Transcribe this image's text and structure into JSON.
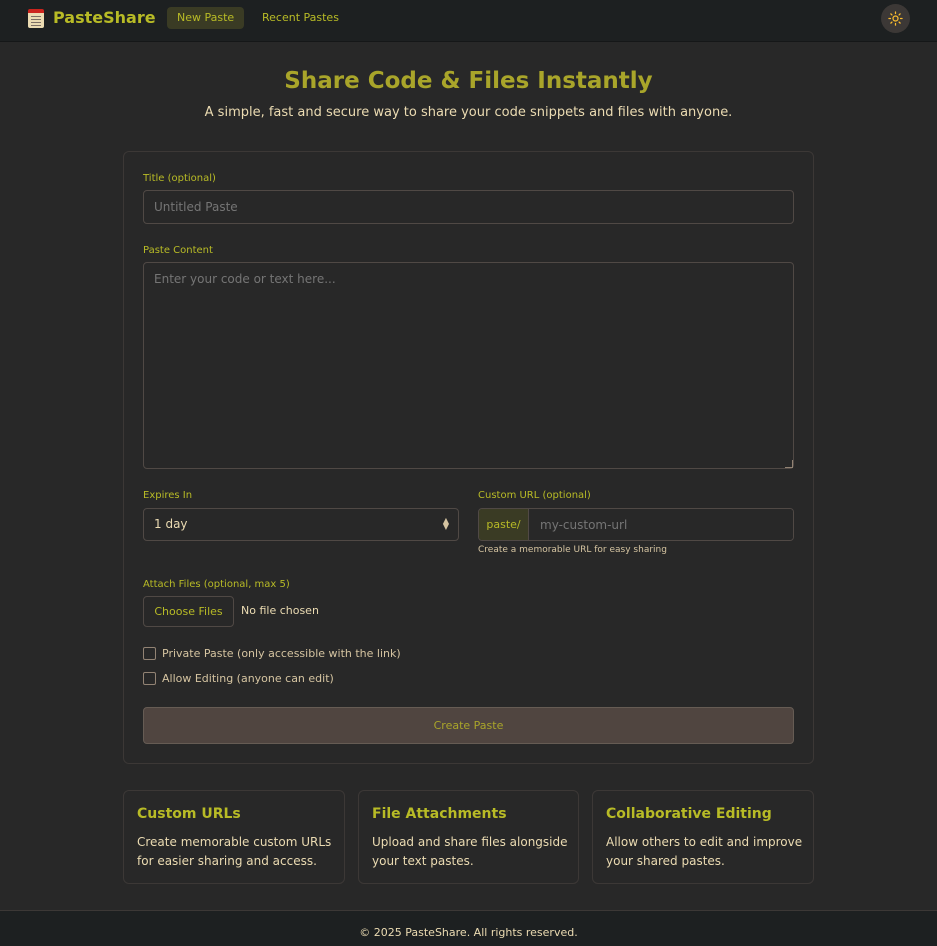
{
  "header": {
    "brand": "PasteShare",
    "nav": {
      "new_paste": "New Paste",
      "recent_pastes": "Recent Pastes"
    },
    "theme_toggle_icon": "sun-icon"
  },
  "hero": {
    "title": "Share Code & Files Instantly",
    "subtitle": "A simple, fast and secure way to share your code snippets and files with anyone."
  },
  "form": {
    "title_label": "Title (optional)",
    "title_placeholder": "Untitled Paste",
    "content_label": "Paste Content",
    "content_placeholder": "Enter your code or text here...",
    "expires_label": "Expires In",
    "expires_value": "1 day",
    "custom_url_label": "Custom URL (optional)",
    "custom_url_prefix": "paste/",
    "custom_url_placeholder": "my-custom-url",
    "custom_url_hint": "Create a memorable URL for easy sharing",
    "attach_label": "Attach Files (optional, max 5)",
    "choose_files": "Choose Files",
    "file_status": "No file chosen",
    "private_label": "Private Paste (only accessible with the link)",
    "private_checked": false,
    "editing_label": "Allow Editing (anyone can edit)",
    "editing_checked": false,
    "submit_label": "Create Paste"
  },
  "features": [
    {
      "title": "Custom URLs",
      "text": "Create memorable custom URLs for easier sharing and access."
    },
    {
      "title": "File Attachments",
      "text": "Upload and share files alongside your text pastes."
    },
    {
      "title": "Collaborative Editing",
      "text": "Allow others to edit and improve your shared pastes."
    }
  ],
  "footer": {
    "copyright": "© 2025 PasteShare. All rights reserved."
  },
  "colors": {
    "background": "#282828",
    "header_bg": "#1d2021",
    "accent": "#b8bb26",
    "heading": "#a9a52a",
    "button_bg": "#504540"
  }
}
